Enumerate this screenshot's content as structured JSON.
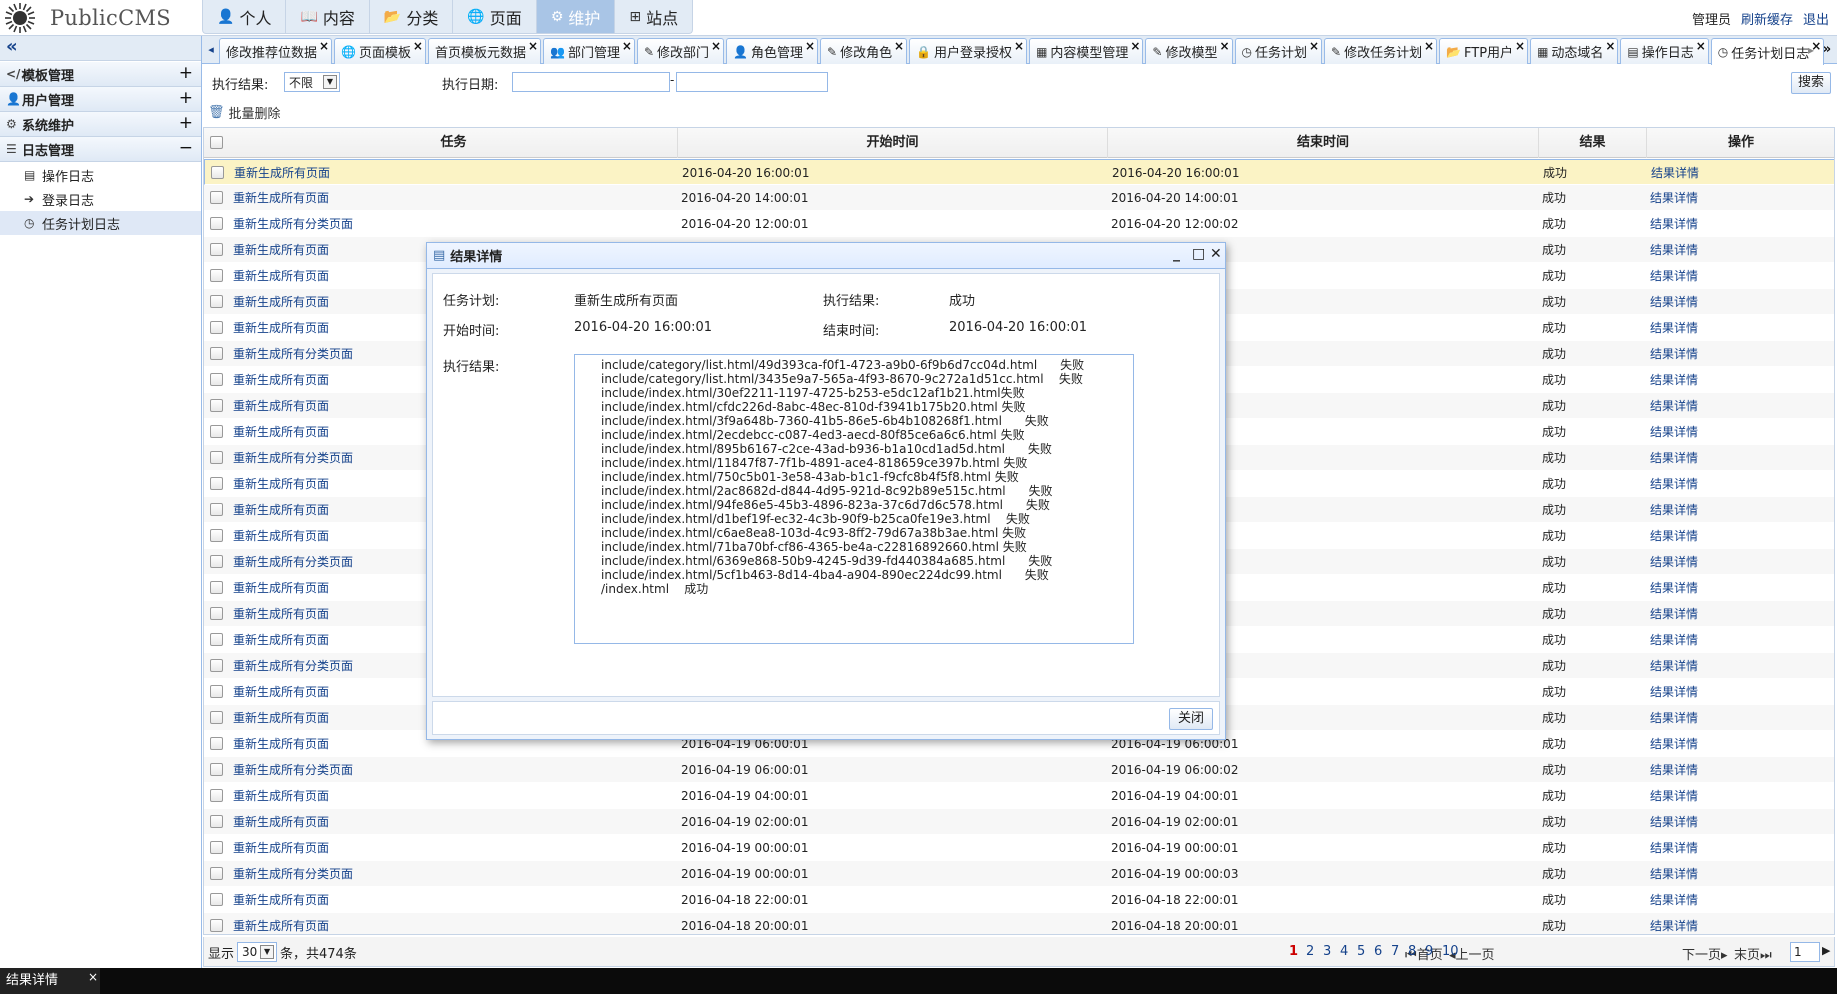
{
  "app": {
    "title": "PublicCMS"
  },
  "main_nav": [
    {
      "icon": "user-icon",
      "glyph": "👤",
      "label": "个人"
    },
    {
      "icon": "book-icon",
      "glyph": "📖",
      "label": "内容"
    },
    {
      "icon": "folder-icon",
      "glyph": "📂",
      "label": "分类"
    },
    {
      "icon": "globe-icon",
      "glyph": "🌐",
      "label": "页面"
    },
    {
      "icon": "gear-icon",
      "glyph": "⚙",
      "label": "维护",
      "active": true
    },
    {
      "icon": "sitemap-icon",
      "glyph": "⊞",
      "label": "站点"
    }
  ],
  "user_bar": {
    "user": "管理员",
    "refresh_cache": "刷新缓存",
    "logout": "退出"
  },
  "sidebar": {
    "collapse_glyph": "«",
    "groups": [
      {
        "icon": "code-icon",
        "glyph": "</>",
        "label": "模板管理",
        "toggle": "+"
      },
      {
        "icon": "user-icon",
        "glyph": "👤",
        "label": "用户管理",
        "toggle": "+"
      },
      {
        "icon": "cogs-icon",
        "glyph": "⚙",
        "label": "系统维护",
        "toggle": "+"
      },
      {
        "icon": "list-icon",
        "glyph": "☰",
        "label": "日志管理",
        "toggle": "−"
      }
    ],
    "log_items": [
      {
        "icon": "table-icon",
        "glyph": "▤",
        "label": "操作日志"
      },
      {
        "icon": "signin-icon",
        "glyph": "➔",
        "label": "登录日志"
      },
      {
        "icon": "clock-icon",
        "glyph": "◷",
        "label": "任务计划日志",
        "active": true
      }
    ]
  },
  "tabs": [
    {
      "glyph": "",
      "label": "修改推荐位数据"
    },
    {
      "glyph": "🌐",
      "label": "页面模板"
    },
    {
      "glyph": "",
      "label": "首页模板元数据"
    },
    {
      "glyph": "👥",
      "label": "部门管理"
    },
    {
      "glyph": "✎",
      "label": "修改部门"
    },
    {
      "glyph": "👤",
      "label": "角色管理"
    },
    {
      "glyph": "✎",
      "label": "修改角色"
    },
    {
      "glyph": "🔒",
      "label": "用户登录授权"
    },
    {
      "glyph": "▦",
      "label": "内容模型管理"
    },
    {
      "glyph": "✎",
      "label": "修改模型"
    },
    {
      "glyph": "◷",
      "label": "任务计划"
    },
    {
      "glyph": "✎",
      "label": "修改任务计划"
    },
    {
      "glyph": "📂",
      "label": "FTP用户"
    },
    {
      "glyph": "▦",
      "label": "动态域名"
    },
    {
      "glyph": "▤",
      "label": "操作日志"
    },
    {
      "glyph": "◷",
      "label": "任务计划日志",
      "active": true
    }
  ],
  "search": {
    "result_label": "执行结果:",
    "result_value": "不限",
    "date_label": "执行日期:",
    "date_sep": "-",
    "button": "搜索"
  },
  "toolbar": {
    "batch_delete": "批量删除"
  },
  "grid": {
    "headers": [
      "任务",
      "开始时间",
      "结束时间",
      "结果",
      "操作"
    ],
    "rows": [
      [
        "重新生成所有页面",
        "2016-04-20 16:00:01",
        "2016-04-20 16:00:01",
        "成功",
        "结果详情"
      ],
      [
        "重新生成所有页面",
        "2016-04-20 14:00:01",
        "2016-04-20 14:00:01",
        "成功",
        "结果详情"
      ],
      [
        "重新生成所有分类页面",
        "2016-04-20 12:00:01",
        "2016-04-20 12:00:02",
        "成功",
        "结果详情"
      ],
      [
        "重新生成所有页面",
        "",
        "",
        "成功",
        "结果详情"
      ],
      [
        "重新生成所有页面",
        "",
        "",
        "成功",
        "结果详情"
      ],
      [
        "重新生成所有页面",
        "",
        "",
        "成功",
        "结果详情"
      ],
      [
        "重新生成所有页面",
        "",
        "",
        "成功",
        "结果详情"
      ],
      [
        "重新生成所有分类页面",
        "",
        "",
        "成功",
        "结果详情"
      ],
      [
        "重新生成所有页面",
        "",
        "",
        "成功",
        "结果详情"
      ],
      [
        "重新生成所有页面",
        "",
        "",
        "成功",
        "结果详情"
      ],
      [
        "重新生成所有页面",
        "",
        "",
        "成功",
        "结果详情"
      ],
      [
        "重新生成所有分类页面",
        "",
        "",
        "成功",
        "结果详情"
      ],
      [
        "重新生成所有页面",
        "",
        "",
        "成功",
        "结果详情"
      ],
      [
        "重新生成所有页面",
        "",
        "",
        "成功",
        "结果详情"
      ],
      [
        "重新生成所有页面",
        "",
        "",
        "成功",
        "结果详情"
      ],
      [
        "重新生成所有分类页面",
        "",
        "",
        "成功",
        "结果详情"
      ],
      [
        "重新生成所有页面",
        "",
        "",
        "成功",
        "结果详情"
      ],
      [
        "重新生成所有页面",
        "",
        "",
        "成功",
        "结果详情"
      ],
      [
        "重新生成所有页面",
        "",
        "",
        "成功",
        "结果详情"
      ],
      [
        "重新生成所有分类页面",
        "",
        "",
        "成功",
        "结果详情"
      ],
      [
        "重新生成所有页面",
        "",
        "",
        "成功",
        "结果详情"
      ],
      [
        "重新生成所有页面",
        "",
        "",
        "成功",
        "结果详情"
      ],
      [
        "重新生成所有页面",
        "2016-04-19 06:00:01",
        "2016-04-19 06:00:01",
        "成功",
        "结果详情"
      ],
      [
        "重新生成所有分类页面",
        "2016-04-19 06:00:01",
        "2016-04-19 06:00:02",
        "成功",
        "结果详情"
      ],
      [
        "重新生成所有页面",
        "2016-04-19 04:00:01",
        "2016-04-19 04:00:01",
        "成功",
        "结果详情"
      ],
      [
        "重新生成所有页面",
        "2016-04-19 02:00:01",
        "2016-04-19 02:00:01",
        "成功",
        "结果详情"
      ],
      [
        "重新生成所有页面",
        "2016-04-19 00:00:01",
        "2016-04-19 00:00:01",
        "成功",
        "结果详情"
      ],
      [
        "重新生成所有分类页面",
        "2016-04-19 00:00:01",
        "2016-04-19 00:00:03",
        "成功",
        "结果详情"
      ],
      [
        "重新生成所有页面",
        "2016-04-18 22:00:01",
        "2016-04-18 22:00:01",
        "成功",
        "结果详情"
      ],
      [
        "重新生成所有页面",
        "2016-04-18 20:00:01",
        "2016-04-18 20:00:01",
        "成功",
        "结果详情"
      ]
    ]
  },
  "pager": {
    "show_label": "显示",
    "page_size": "30",
    "total_text": "条，共474条",
    "first": "首页",
    "prev": "上一页",
    "pages": [
      "1",
      "2",
      "3",
      "4",
      "5",
      "6",
      "7",
      "8",
      "9",
      "10"
    ],
    "current": "1",
    "next": "下一页",
    "last": "末页",
    "jump_value": "1"
  },
  "dialog": {
    "title": "结果详情",
    "task_label": "任务计划:",
    "task_value": "重新生成所有页面",
    "result_label": "执行结果:",
    "result_value": "成功",
    "start_label": "开始时间:",
    "start_value": "2016-04-20 16:00:01",
    "end_label": "结束时间:",
    "end_value": "2016-04-20 16:00:01",
    "detail_label": "执行结果:",
    "detail_text": "include/category/list.html/49d393ca-f0f1-4723-a9b0-6f9b6d7cc04d.html      失败\ninclude/category/list.html/3435e9a7-565a-4f93-8670-9c272a1d51cc.html    失败\ninclude/index.html/30ef2211-1197-4725-b253-e5dc12af1b21.html失败\ninclude/index.html/cfdc226d-8abc-48ec-810d-f3941b175b20.html 失败\ninclude/index.html/3f9a648b-7360-41b5-86e5-6b4b108268f1.html      失败\ninclude/index.html/2ecdebcc-c087-4ed3-aecd-80f85ce6a6c6.html 失败\ninclude/index.html/895b6167-c2ce-43ad-b936-b1a10cd1ad5d.html      失败\ninclude/index.html/11847f87-7f1b-4891-ace4-818659ce397b.html 失败\ninclude/index.html/750c5b01-3e58-43ab-b1c1-f9cfc8b4f5f8.html 失败\ninclude/index.html/2ac8682d-d844-4d95-921d-8c92b89e515c.html      失败\ninclude/index.html/94fe86e5-45b3-4896-823a-37c6d7d6c578.html      失败\ninclude/index.html/d1bef19f-ec32-4c3b-90f9-b25ca0fe19e3.html    失败\ninclude/index.html/c6ae8ea8-103d-4c93-8ff2-79d67a38b3ae.html 失败\ninclude/index.html/71ba70bf-cf86-4365-be4a-c22816892660.html 失败\ninclude/index.html/6369e868-50b9-4245-9d39-fd440384a685.html      失败\ninclude/index.html/5cf1b463-8d14-4ba4-a904-890ec224dc99.html      失败\n/index.html    成功",
    "close_button": "关闭"
  },
  "taskbar": {
    "item": "结果详情",
    "close": "×"
  },
  "colors": {
    "link": "#15428b",
    "selected_row": "#fbf3c5",
    "header_blue": "#e2ebf5",
    "border": "#95b8e7"
  }
}
